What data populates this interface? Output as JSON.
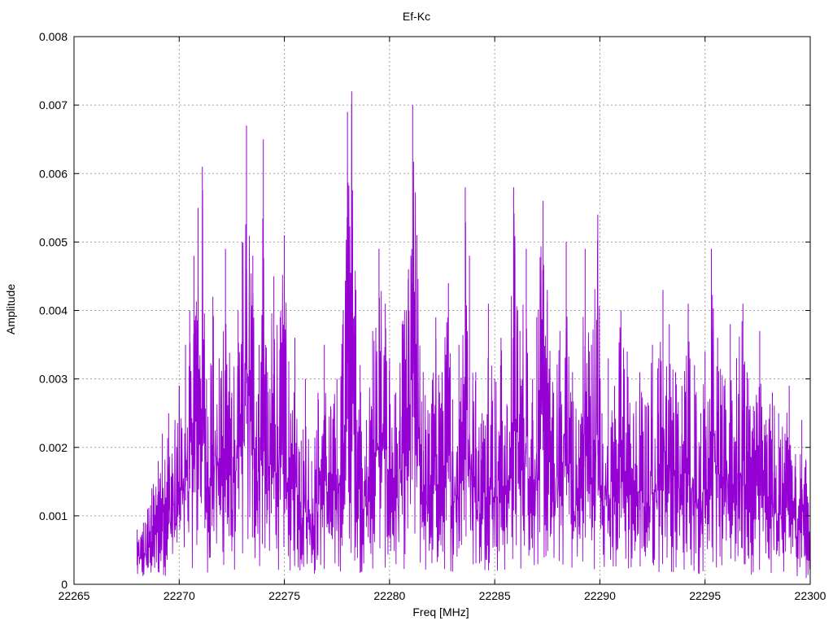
{
  "chart_data": {
    "type": "line",
    "title": "Ef-Kc",
    "xlabel": "Freq [MHz]",
    "ylabel": "Amplitude",
    "xlim": [
      22265,
      22300
    ],
    "ylim": [
      0,
      0.008
    ],
    "grid": true,
    "legend": "none",
    "x_ticks": [
      "22265",
      "22270",
      "22275",
      "22280",
      "22285",
      "22290",
      "22295",
      "22300"
    ],
    "y_ticks": [
      "0",
      "0.001",
      "0.002",
      "0.003",
      "0.004",
      "0.005",
      "0.006",
      "0.007",
      "0.008"
    ],
    "series": [
      {
        "color": "#9400d3",
        "x_start": 22268.0,
        "x_end": 22300.0,
        "x": [
          22268.0,
          22268.3,
          22268.5,
          22268.7,
          22269.0,
          22269.2,
          22269.5,
          22269.8,
          22270.0,
          22270.3,
          22270.5,
          22270.7,
          22270.9,
          22271.1,
          22271.3,
          22271.6,
          22271.9,
          22272.2,
          22272.5,
          22272.8,
          22273.0,
          22273.2,
          22273.5,
          22273.8,
          22274.0,
          22274.2,
          22274.5,
          22274.8,
          22275.0,
          22275.3,
          22275.5,
          22275.8,
          22276.0,
          22276.3,
          22276.6,
          22276.9,
          22277.2,
          22277.5,
          22277.8,
          22278.0,
          22278.2,
          22278.4,
          22278.6,
          22278.9,
          22279.2,
          22279.5,
          22279.8,
          22280.0,
          22280.3,
          22280.6,
          22280.9,
          22281.1,
          22281.3,
          22281.6,
          22281.9,
          22282.2,
          22282.5,
          22282.8,
          22283.0,
          22283.3,
          22283.6,
          22283.8,
          22284.1,
          22284.4,
          22284.7,
          22285.0,
          22285.3,
          22285.6,
          22285.9,
          22286.2,
          22286.5,
          22286.8,
          22287.0,
          22287.3,
          22287.5,
          22287.8,
          22288.1,
          22288.4,
          22288.7,
          22289.0,
          22289.3,
          22289.6,
          22289.9,
          22290.1,
          22290.4,
          22290.7,
          22291.0,
          22291.3,
          22291.6,
          22291.9,
          22292.2,
          22292.5,
          22292.8,
          22293.0,
          22293.3,
          22293.6,
          22293.9,
          22294.2,
          22294.5,
          22294.8,
          22295.0,
          22295.3,
          22295.6,
          22295.9,
          22296.2,
          22296.5,
          22296.8,
          22297.0,
          22297.3,
          22297.6,
          22297.9,
          22298.2,
          22298.5,
          22298.8,
          22299.0,
          22299.3,
          22299.6,
          22299.8,
          22300.0
        ],
        "y": [
          0.0008,
          0.0009,
          0.0011,
          0.0014,
          0.0018,
          0.0022,
          0.0025,
          0.0024,
          0.0029,
          0.0035,
          0.004,
          0.0048,
          0.0055,
          0.0061,
          0.003,
          0.0042,
          0.0033,
          0.0049,
          0.0028,
          0.004,
          0.005,
          0.0067,
          0.0048,
          0.0035,
          0.0065,
          0.0031,
          0.0045,
          0.0039,
          0.0051,
          0.0025,
          0.0036,
          0.0021,
          0.003,
          0.0018,
          0.0028,
          0.0035,
          0.0026,
          0.003,
          0.004,
          0.0069,
          0.0072,
          0.0043,
          0.0032,
          0.0024,
          0.0037,
          0.0049,
          0.0041,
          0.0033,
          0.0028,
          0.0038,
          0.0046,
          0.007,
          0.0051,
          0.0031,
          0.0025,
          0.0039,
          0.0031,
          0.0044,
          0.0027,
          0.0035,
          0.0058,
          0.0048,
          0.0031,
          0.0025,
          0.0041,
          0.003,
          0.0036,
          0.0026,
          0.0058,
          0.0037,
          0.0049,
          0.003,
          0.0039,
          0.0056,
          0.0043,
          0.0028,
          0.0037,
          0.005,
          0.0031,
          0.0024,
          0.0049,
          0.0035,
          0.0054,
          0.0025,
          0.0033,
          0.0029,
          0.004,
          0.0034,
          0.0025,
          0.0031,
          0.0026,
          0.0035,
          0.0033,
          0.0043,
          0.0038,
          0.0031,
          0.0029,
          0.0041,
          0.0032,
          0.0025,
          0.0034,
          0.0049,
          0.0036,
          0.0029,
          0.0038,
          0.0033,
          0.0041,
          0.0031,
          0.0026,
          0.0037,
          0.0024,
          0.0028,
          0.0025,
          0.0022,
          0.0029,
          0.0019,
          0.0024,
          0.0018,
          0.0014
        ]
      }
    ]
  }
}
